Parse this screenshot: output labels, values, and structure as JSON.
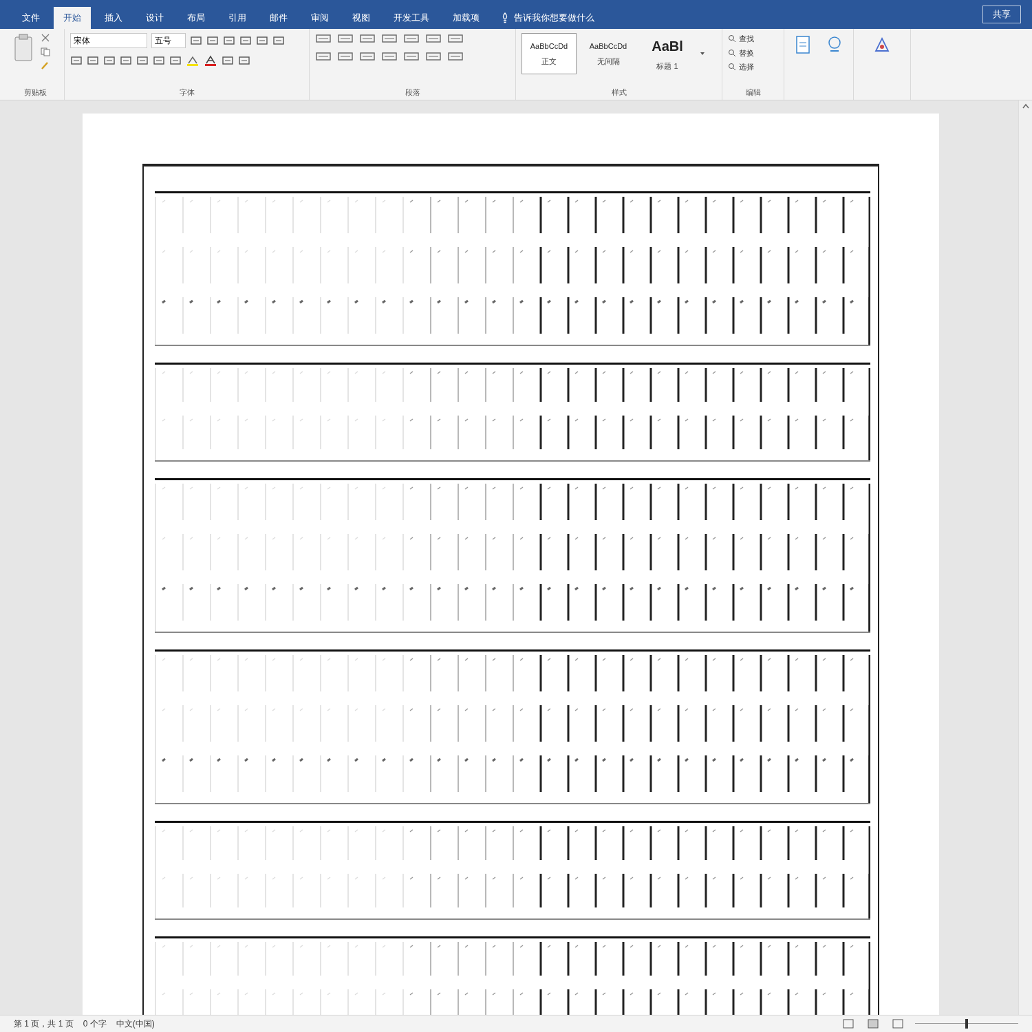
{
  "tabs": [
    {
      "label": "文件",
      "selected": false
    },
    {
      "label": "开始",
      "selected": true
    },
    {
      "label": "插入",
      "selected": false
    },
    {
      "label": "设计",
      "selected": false
    },
    {
      "label": "布局",
      "selected": false
    },
    {
      "label": "引用",
      "selected": false
    },
    {
      "label": "邮件",
      "selected": false
    },
    {
      "label": "审阅",
      "selected": false
    },
    {
      "label": "视图",
      "selected": false
    },
    {
      "label": "开发工具",
      "selected": false
    },
    {
      "label": "加载项",
      "selected": false
    }
  ],
  "tell_me": "告诉我你想要做什么",
  "share": "共享",
  "ribbon": {
    "clipboard": {
      "label": "剪贴板"
    },
    "font": {
      "label": "字体",
      "name": "宋体",
      "size": "五号"
    },
    "paragraph": {
      "label": "段落"
    },
    "styles": {
      "label": "样式",
      "items": [
        {
          "preview": "AaBbCcDd",
          "name": "正文",
          "selected": true
        },
        {
          "preview": "AaBbCcDd",
          "name": "无间隔",
          "selected": false
        },
        {
          "preview": "AaBl",
          "name": "标题 1",
          "selected": false
        }
      ]
    },
    "editing": {
      "label": "编辑",
      "items": [
        "查找",
        "替换",
        "选择"
      ]
    }
  },
  "document": {
    "blocks": [
      {
        "kind": "tall"
      },
      {
        "kind": "short"
      },
      {
        "kind": "tall"
      },
      {
        "kind": "tall"
      },
      {
        "kind": "short"
      },
      {
        "kind": "short"
      }
    ]
  },
  "status_bar": {
    "page": "第 1 页，共 1 页",
    "words": "0 个字",
    "language": "中文(中国)",
    "zoom": {
      "level": 0.5
    }
  }
}
